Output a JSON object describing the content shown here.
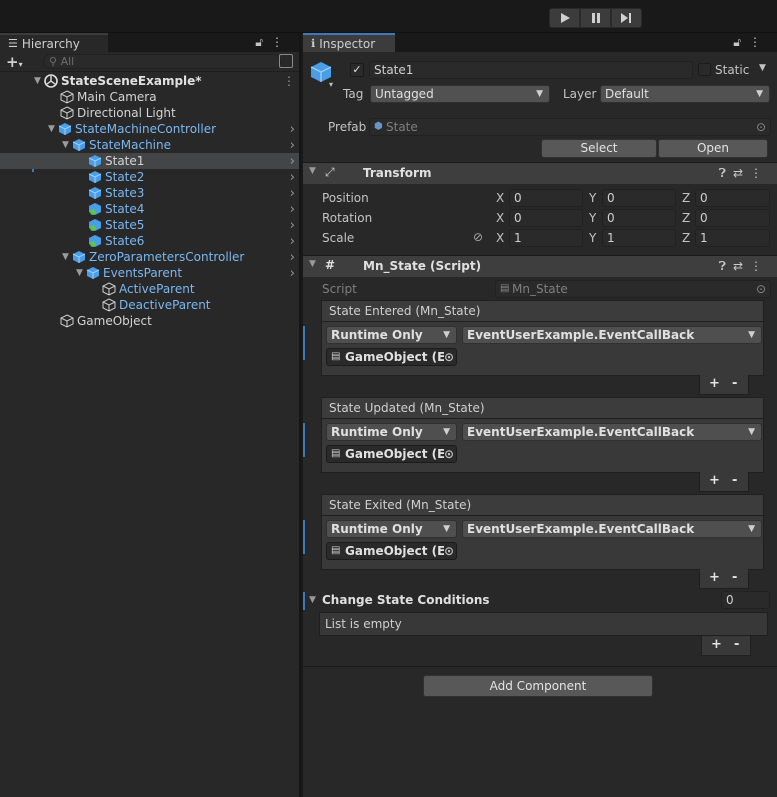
{
  "toolbar": {
    "play": "play-icon",
    "pause": "pause-icon",
    "step": "step-icon"
  },
  "hierarchy": {
    "tab_label": "Hierarchy",
    "search_placeholder": "All",
    "scene_name": "StateSceneExample*",
    "items": [
      {
        "label": "Main Camera"
      },
      {
        "label": "Directional Light"
      },
      {
        "label": "StateMachineController"
      },
      {
        "label": "StateMachine"
      },
      {
        "label": "State1"
      },
      {
        "label": "State2"
      },
      {
        "label": "State3"
      },
      {
        "label": "State4"
      },
      {
        "label": "State5"
      },
      {
        "label": "State6"
      },
      {
        "label": "ZeroParametersController"
      },
      {
        "label": "EventsParent"
      },
      {
        "label": "ActiveParent"
      },
      {
        "label": "DeactiveParent"
      },
      {
        "label": "GameObject"
      }
    ]
  },
  "inspector": {
    "tab_label": "Inspector",
    "object_name": "State1",
    "static_label": "Static",
    "tag_label": "Tag",
    "tag_value": "Untagged",
    "layer_label": "Layer",
    "layer_value": "Default",
    "prefab_label": "Prefab",
    "prefab_value": "State",
    "select_label": "Select",
    "open_label": "Open",
    "transform": {
      "title": "Transform",
      "position_label": "Position",
      "rotation_label": "Rotation",
      "scale_label": "Scale",
      "x": "X",
      "y": "Y",
      "z": "Z",
      "position": [
        "0",
        "0",
        "0"
      ],
      "rotation": [
        "0",
        "0",
        "0"
      ],
      "scale": [
        "1",
        "1",
        "1"
      ]
    },
    "script_component": {
      "title": "Mn_State (Script)",
      "script_label": "Script",
      "script_value": "Mn_State",
      "events": [
        {
          "title": "State Entered (Mn_State)",
          "mode": "Runtime Only",
          "function": "EventUserExample.EventCallBack",
          "object": "GameObject (Ev"
        },
        {
          "title": "State Updated (Mn_State)",
          "mode": "Runtime Only",
          "function": "EventUserExample.EventCallBack",
          "object": "GameObject (Ev"
        },
        {
          "title": "State Exited (Mn_State)",
          "mode": "Runtime Only",
          "function": "EventUserExample.EventCallBack",
          "object": "GameObject (Ev"
        }
      ],
      "plus": "+",
      "minus": "-",
      "conditions_label": "Change State Conditions",
      "conditions_count": "0",
      "list_empty": "List is empty"
    },
    "add_component_label": "Add Component"
  },
  "colors": {
    "accent": "#3a79bb",
    "link_blue": "#7bb7f0",
    "panel": "#282828"
  }
}
